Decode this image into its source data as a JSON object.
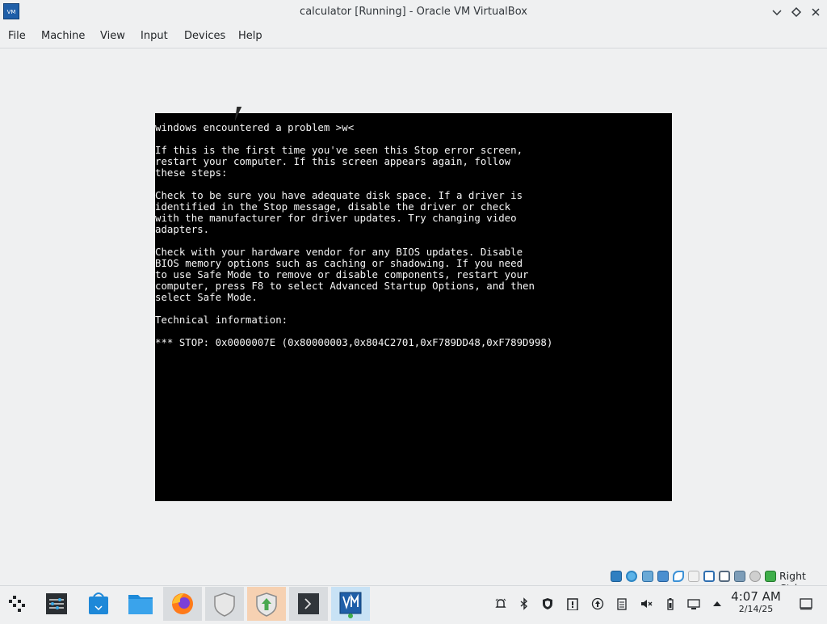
{
  "window": {
    "title": "calculator [Running] - Oracle VM VirtualBox",
    "icon_name": "virtualbox-app-icon",
    "controls": [
      "minimize",
      "maximize",
      "close"
    ]
  },
  "menu": {
    "items": [
      "File",
      "Machine",
      "View",
      "Input",
      "Devices",
      "Help"
    ]
  },
  "bsod": {
    "text": "windows encountered a problem >w<\n\nIf this is the first time you've seen this Stop error screen,\nrestart your computer. If this screen appears again, follow\nthese steps:\n\nCheck to be sure you have adequate disk space. If a driver is\nidentified in the Stop message, disable the driver or check\nwith the manufacturer for driver updates. Try changing video\nadapters.\n\nCheck with your hardware vendor for any BIOS updates. Disable\nBIOS memory options such as caching or shadowing. If you need\nto use Safe Mode to remove or disable components, restart your\ncomputer, press F8 to select Advanced Startup Options, and then\nselect Safe Mode.\n\nTechnical information:\n\n*** STOP: 0x0000007E (0x80000003,0x804C2701,0xF789DD48,0xF789D998)",
    "background": "#000000",
    "text_color": "#f5f5f5"
  },
  "status_bar": {
    "icons": [
      "hard-disk-icon",
      "optical-drive-icon",
      "audio-icon",
      "network-icon",
      "usb-icon",
      "shared-folder-icon",
      "display-icon",
      "recording-icon",
      "cpu-icon",
      "mouse-integration-icon",
      "keyboard-icon"
    ],
    "host_key": "Right Ctrl"
  },
  "taskbar": {
    "apps": [
      "app-launcher",
      "system-settings",
      "discover",
      "file-manager",
      "firefox",
      "security",
      "updates",
      "terminal",
      "virtualbox"
    ],
    "active_app": "virtualbox",
    "tray_icons": [
      "notifications-icon",
      "bluetooth-icon",
      "vpn-shield-icon",
      "clipboard-icon",
      "update-icon",
      "printer-icon",
      "volume-muted-icon",
      "battery-icon",
      "network-icon",
      "tray-expand-icon"
    ],
    "clock_time": "4:07 AM",
    "clock_date": "2/14/25"
  },
  "colors": {
    "chrome": "#eff0f1",
    "accent": "#3daee9",
    "active_task": "#c8e2f5"
  }
}
